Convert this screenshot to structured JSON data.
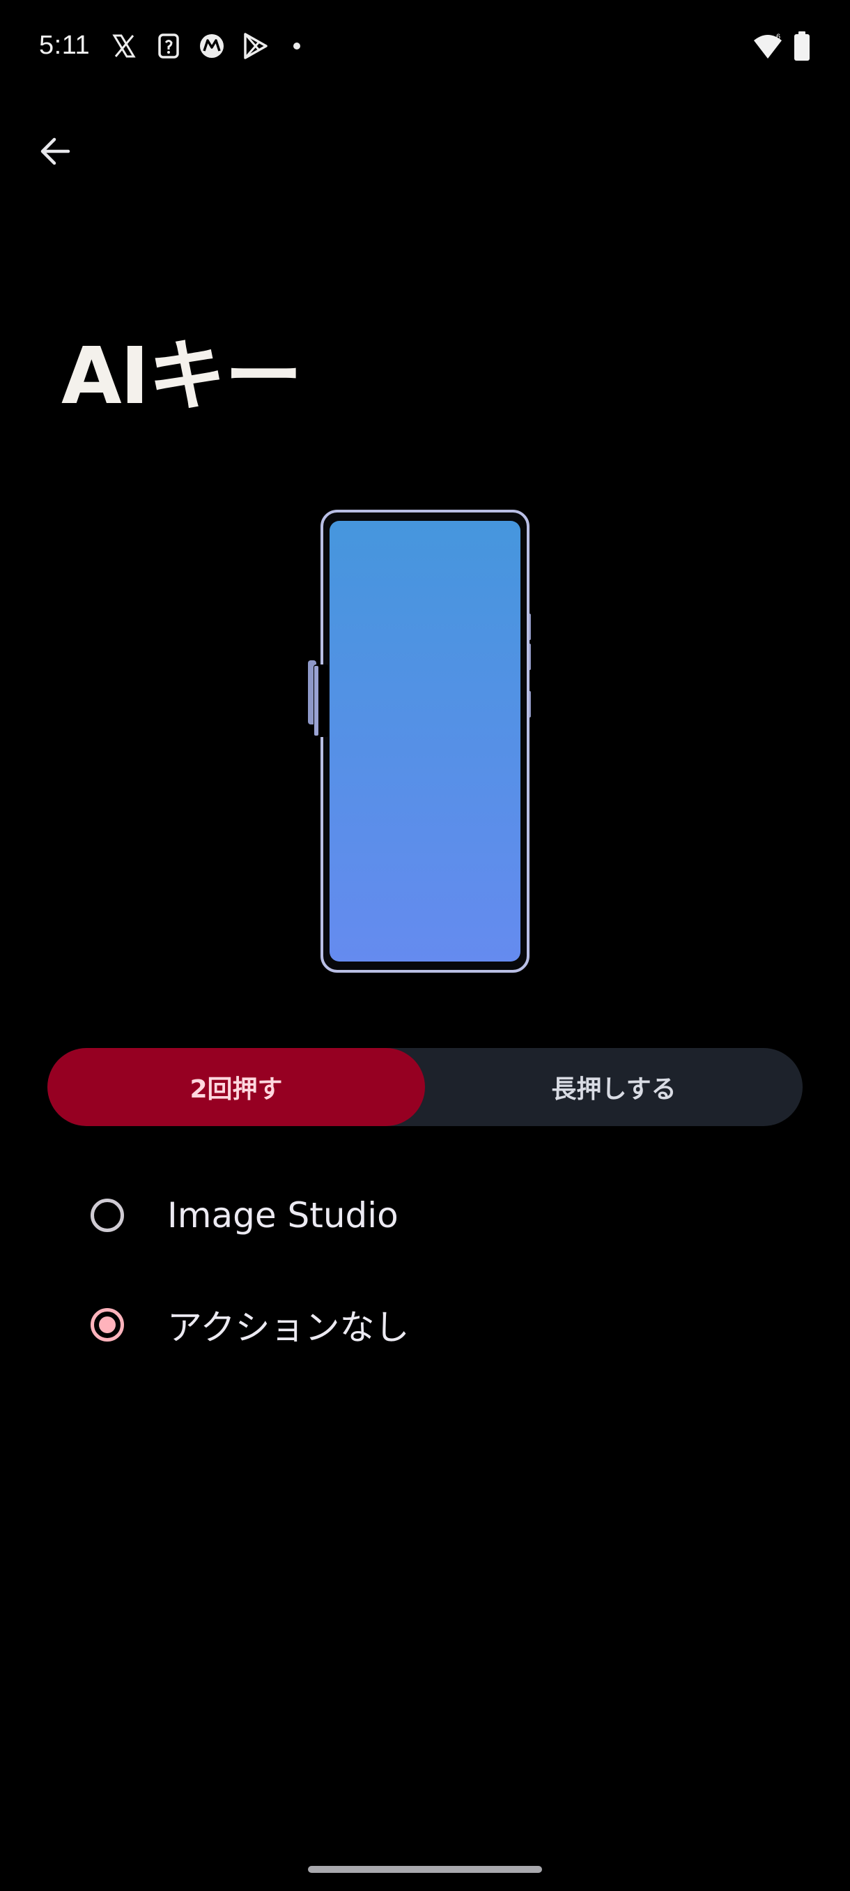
{
  "status_bar": {
    "time": "5:11",
    "notification_icons": [
      "x-icon",
      "card-icon",
      "motorola-icon",
      "play-store-icon",
      "dot-icon"
    ],
    "system_icons": [
      "wifi-icon",
      "battery-icon"
    ]
  },
  "header": {
    "back_icon": "arrow-left-icon"
  },
  "page": {
    "title": "AIキー"
  },
  "segmented": {
    "options": [
      {
        "label": "2回押す",
        "selected": true
      },
      {
        "label": "長押しする",
        "selected": false
      }
    ]
  },
  "actions": [
    {
      "label": "Image Studio",
      "selected": false
    },
    {
      "label": "アクションなし",
      "selected": true
    }
  ],
  "colors": {
    "background": "#000000",
    "accent": "#960022",
    "accent_text": "#FFD8DF",
    "segment_bg": "#1D222B",
    "radio_selected": "#FFB3BC"
  }
}
